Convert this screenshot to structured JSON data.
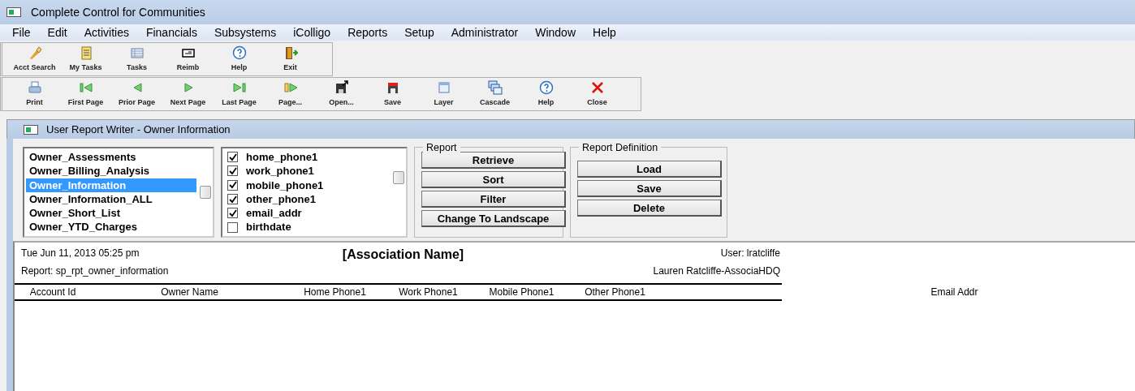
{
  "window": {
    "title": "Complete Control for Communities"
  },
  "menu": [
    "File",
    "Edit",
    "Activities",
    "Financials",
    "Subsystems",
    "iColligo",
    "Reports",
    "Setup",
    "Administrator",
    "Window",
    "Help"
  ],
  "toolbar_1": [
    "Acct Search",
    "My Tasks",
    "Tasks",
    "Reimb",
    "Help",
    "Exit"
  ],
  "toolbar_2": [
    "Print",
    "First Page",
    "Prior Page",
    "Next Page",
    "Last Page",
    "Page...",
    "Open...",
    "Save",
    "Layer",
    "Cascade",
    "Help",
    "Close"
  ],
  "child_window": {
    "title": "User Report Writer - Owner Information",
    "reports": [
      {
        "label": "Owner_Assessments",
        "selected": false
      },
      {
        "label": "Owner_Billing_Analysis",
        "selected": false
      },
      {
        "label": "Owner_Information",
        "selected": true
      },
      {
        "label": "Owner_Information_ALL",
        "selected": false
      },
      {
        "label": "Owner_Short_List",
        "selected": false
      },
      {
        "label": "Owner_YTD_Charges",
        "selected": false
      }
    ],
    "fields": [
      {
        "label": "home_phone1",
        "checked": true
      },
      {
        "label": "work_phone1",
        "checked": true
      },
      {
        "label": "mobile_phone1",
        "checked": true
      },
      {
        "label": "other_phone1",
        "checked": true
      },
      {
        "label": "email_addr",
        "checked": true
      },
      {
        "label": "birthdate",
        "checked": false
      }
    ],
    "report_group": {
      "title": "Report",
      "buttons": [
        "Retrieve",
        "Sort",
        "Filter",
        "Change To Landscape"
      ]
    },
    "definition_group": {
      "title": "Report Definition",
      "buttons": [
        "Load",
        "Save",
        "Delete"
      ]
    },
    "preview": {
      "date": "Tue Jun 11, 2013 05:25 pm",
      "report": "Report: sp_rpt_owner_information",
      "association": "[Association Name]",
      "user": "User: lratcliffe",
      "user_name": "Lauren Ratcliffe-AssociaHDQ",
      "columns": [
        "Account Id",
        "Owner Name",
        "Home Phone1",
        "Work Phone1",
        "Mobile Phone1",
        "Other Phone1",
        "Email Addr"
      ]
    }
  }
}
